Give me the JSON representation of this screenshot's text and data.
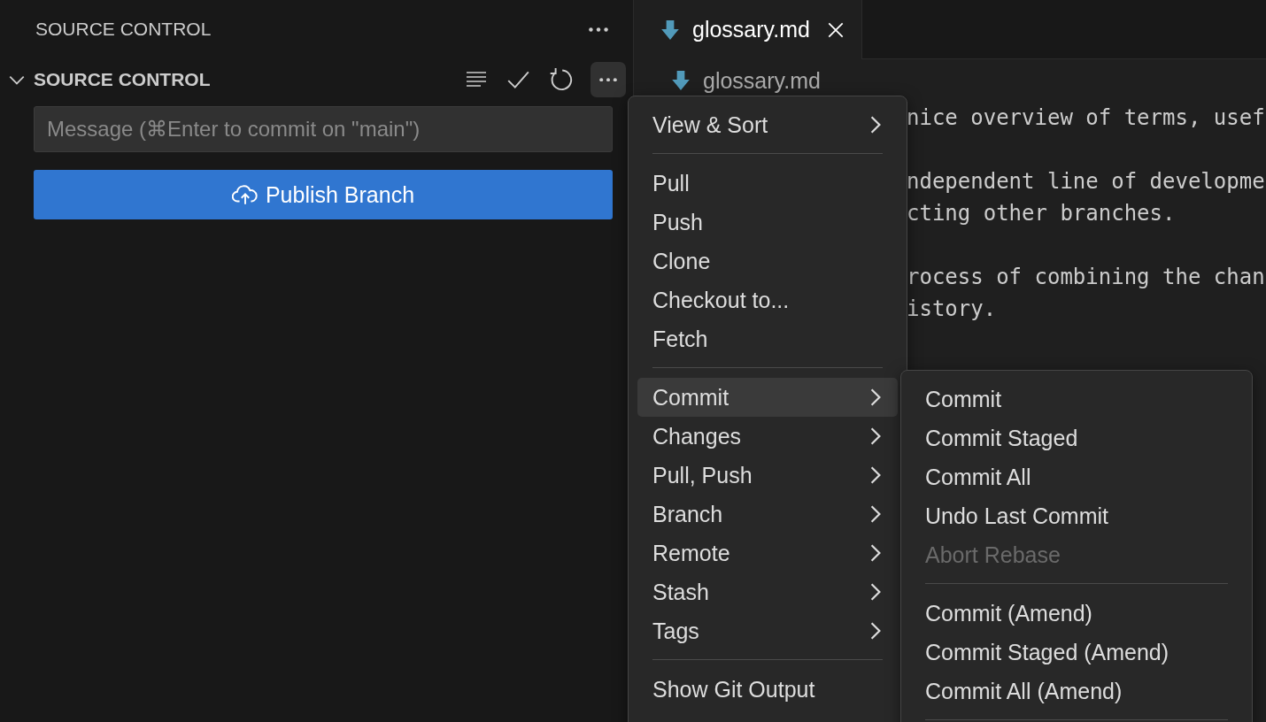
{
  "sidebar": {
    "title": "SOURCE CONTROL",
    "section": {
      "title": "SOURCE CONTROL",
      "expanded": true
    },
    "message": {
      "placeholder": "Message (⌘Enter to commit on \"main\")"
    },
    "publish_button": "Publish Branch"
  },
  "tabs": [
    {
      "label": "glossary.md",
      "selected": true
    }
  ],
  "breadcrumb": "glossary.md",
  "editor_paragraphs": [
    [
      "nice overview of terms, usef"
    ],
    [
      "ndependent line of developme",
      "cting other branches."
    ],
    [
      "rocess of combining the chan",
      "istory."
    ]
  ],
  "menu": [
    {
      "kind": "item",
      "label": "View & Sort",
      "submenu": true,
      "selected": false,
      "disabled": false
    },
    {
      "kind": "separator"
    },
    {
      "kind": "item",
      "label": "Pull",
      "submenu": false,
      "selected": false,
      "disabled": false
    },
    {
      "kind": "item",
      "label": "Push",
      "submenu": false,
      "selected": false,
      "disabled": false
    },
    {
      "kind": "item",
      "label": "Clone",
      "submenu": false,
      "selected": false,
      "disabled": false
    },
    {
      "kind": "item",
      "label": "Checkout to...",
      "submenu": false,
      "selected": false,
      "disabled": false
    },
    {
      "kind": "item",
      "label": "Fetch",
      "submenu": false,
      "selected": false,
      "disabled": false
    },
    {
      "kind": "separator"
    },
    {
      "kind": "item",
      "label": "Commit",
      "submenu": true,
      "selected": true,
      "disabled": false
    },
    {
      "kind": "item",
      "label": "Changes",
      "submenu": true,
      "selected": false,
      "disabled": false
    },
    {
      "kind": "item",
      "label": "Pull, Push",
      "submenu": true,
      "selected": false,
      "disabled": false
    },
    {
      "kind": "item",
      "label": "Branch",
      "submenu": true,
      "selected": false,
      "disabled": false
    },
    {
      "kind": "item",
      "label": "Remote",
      "submenu": true,
      "selected": false,
      "disabled": false
    },
    {
      "kind": "item",
      "label": "Stash",
      "submenu": true,
      "selected": false,
      "disabled": false
    },
    {
      "kind": "item",
      "label": "Tags",
      "submenu": true,
      "selected": false,
      "disabled": false
    },
    {
      "kind": "separator"
    },
    {
      "kind": "item",
      "label": "Show Git Output",
      "submenu": false,
      "selected": false,
      "disabled": false
    }
  ],
  "submenu": [
    {
      "kind": "item",
      "label": "Commit",
      "disabled": false
    },
    {
      "kind": "item",
      "label": "Commit Staged",
      "disabled": false
    },
    {
      "kind": "item",
      "label": "Commit All",
      "disabled": false
    },
    {
      "kind": "item",
      "label": "Undo Last Commit",
      "disabled": false
    },
    {
      "kind": "item",
      "label": "Abort Rebase",
      "disabled": true
    },
    {
      "kind": "separator"
    },
    {
      "kind": "item",
      "label": "Commit (Amend)",
      "disabled": false
    },
    {
      "kind": "item",
      "label": "Commit Staged (Amend)",
      "disabled": false
    },
    {
      "kind": "item",
      "label": "Commit All (Amend)",
      "disabled": false
    },
    {
      "kind": "separator"
    }
  ]
}
